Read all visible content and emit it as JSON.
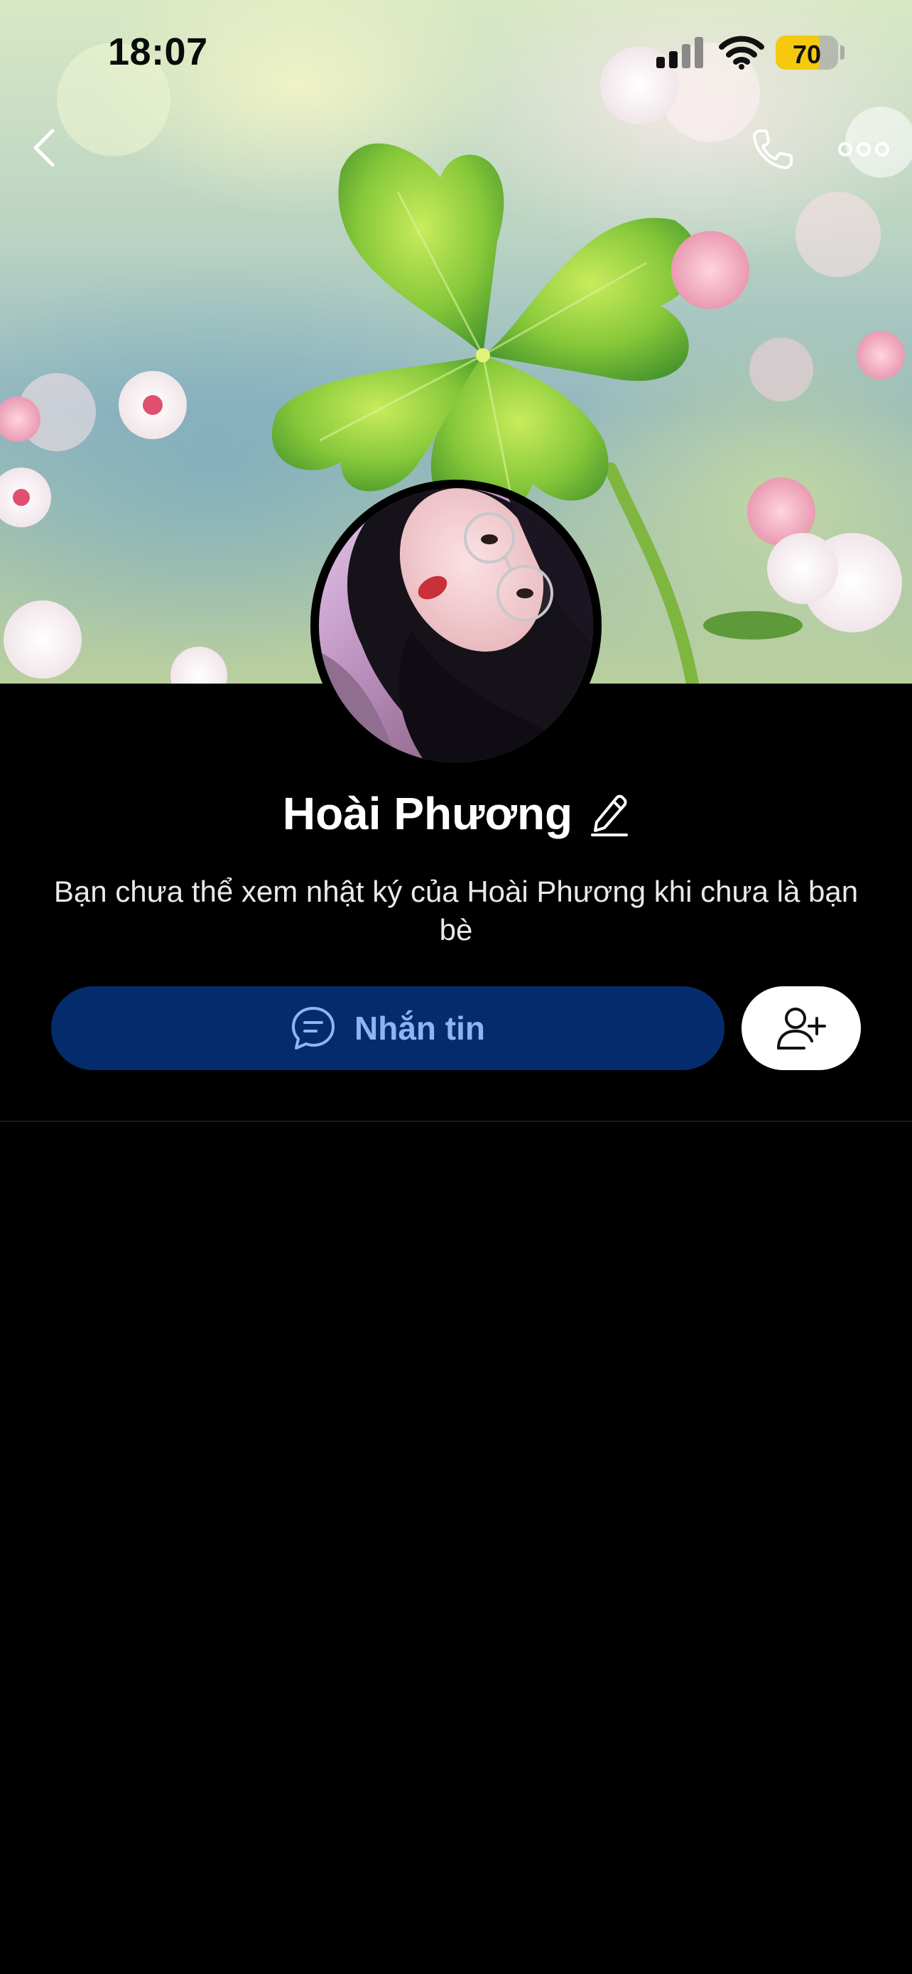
{
  "status_bar": {
    "time": "18:07",
    "battery_percent": "70",
    "battery_level": 0.7,
    "signal_bars_active": 2,
    "signal_bars_total": 4
  },
  "nav": {
    "back_icon": "chevron-left-icon",
    "call_icon": "phone-icon",
    "more_icon": "more-dots-icon"
  },
  "profile": {
    "name": "Hoài Phương",
    "privacy_note": "Bạn chưa thể xem nhật ký của Hoài Phương khi chưa là bạn bè"
  },
  "actions": {
    "message_label": "Nhắn tin",
    "message_icon": "chat-bubble-icon",
    "add_friend_icon": "add-user-icon"
  },
  "colors": {
    "background": "#000000",
    "message_button_bg": "#042c6d",
    "message_button_text": "#8fb4f4",
    "battery_yellow": "#f6c90e"
  }
}
